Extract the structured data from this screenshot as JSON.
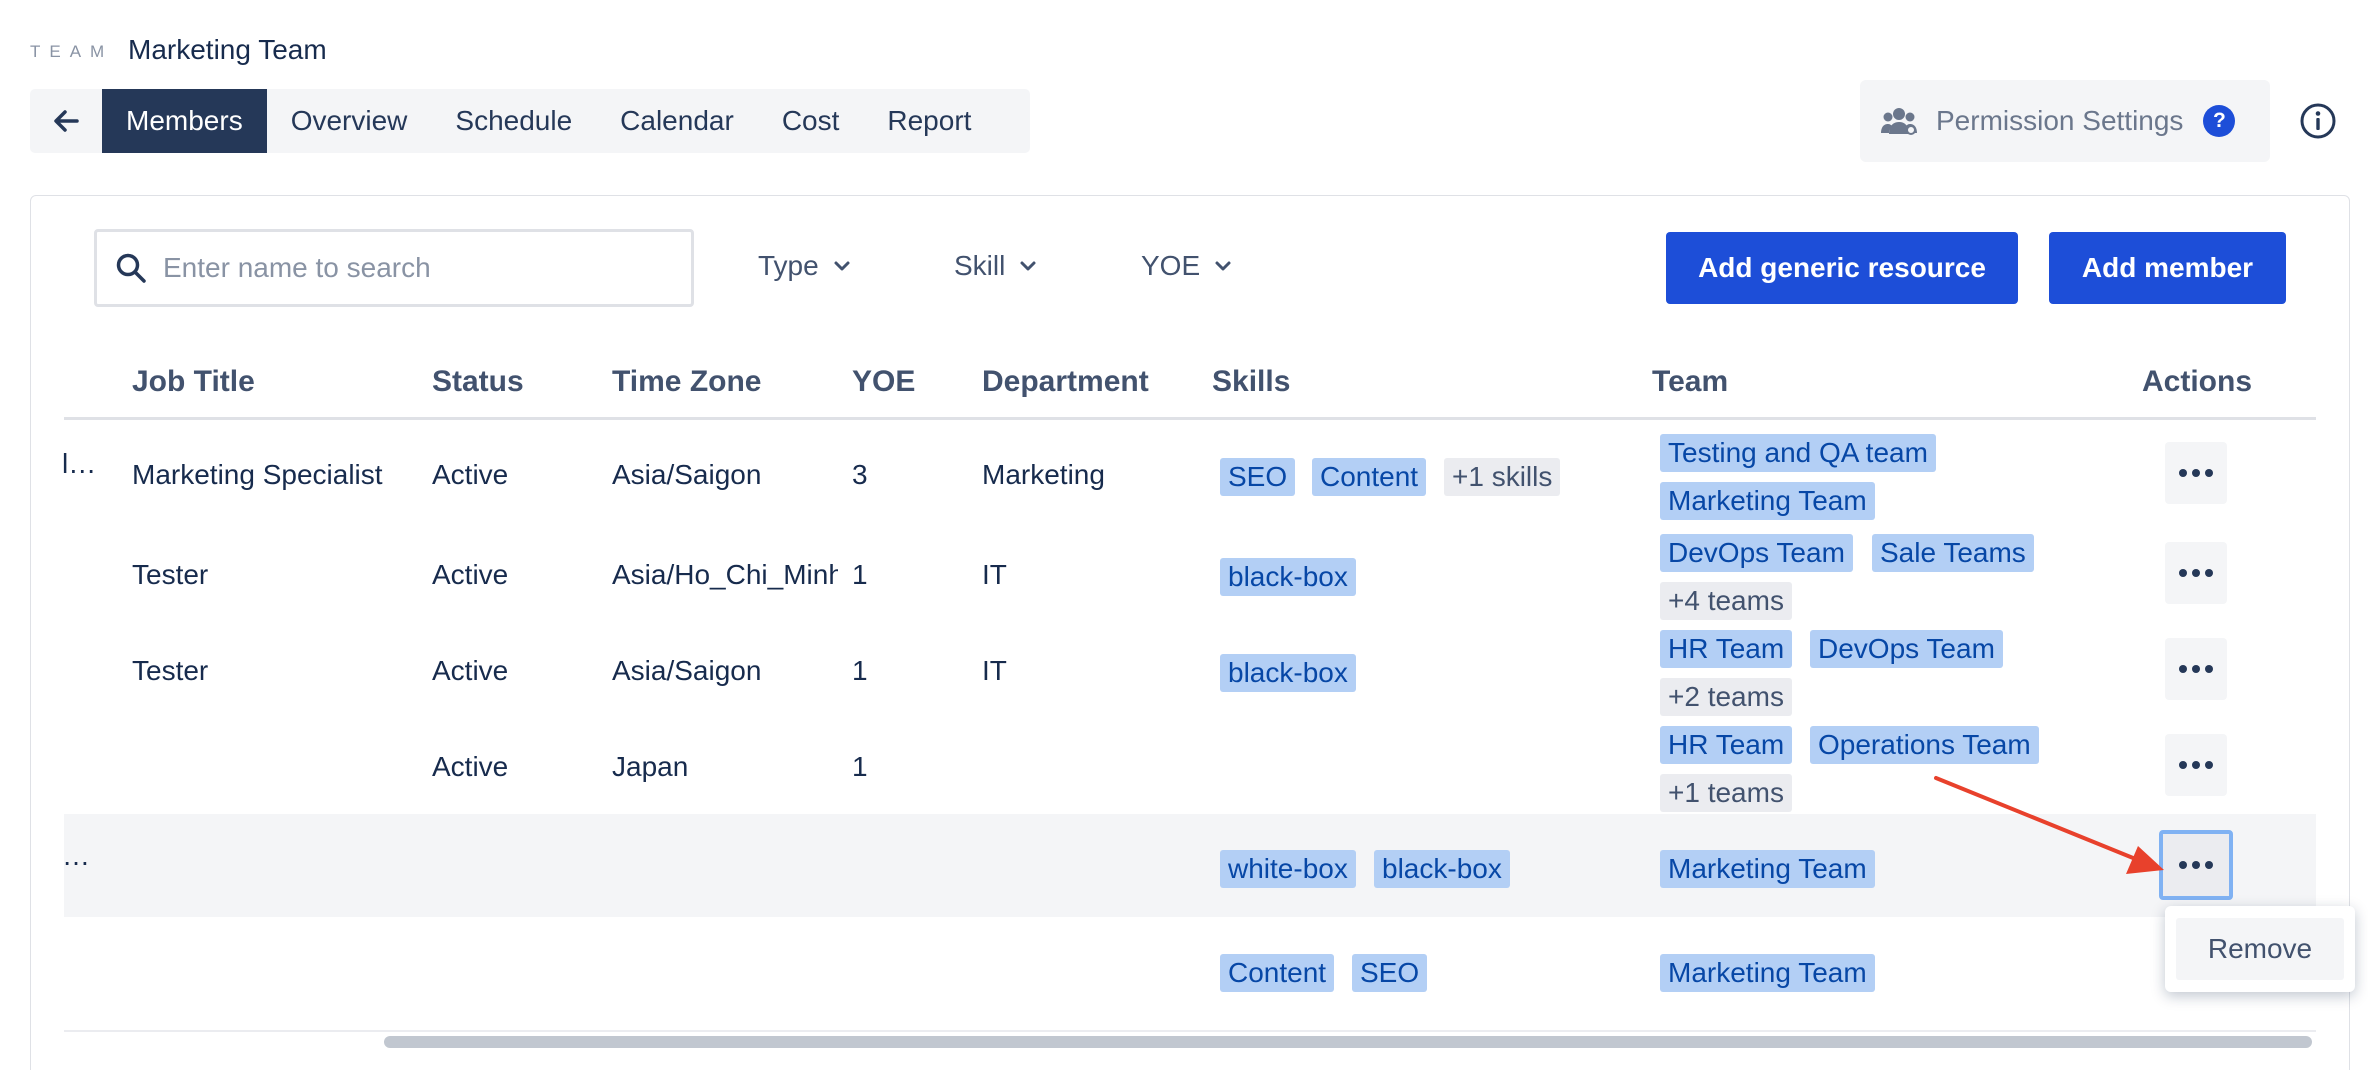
{
  "header": {
    "section_label": "TEAM",
    "team_name": "Marketing Team"
  },
  "tabs": [
    "Members",
    "Overview",
    "Schedule",
    "Calendar",
    "Cost",
    "Report"
  ],
  "active_tab": "Members",
  "permission": {
    "label": "Permission Settings",
    "help": "?"
  },
  "toolbar": {
    "search_placeholder": "Enter name to search",
    "filters": [
      "Type",
      "Skill",
      "YOE"
    ],
    "add_generic_label": "Add generic resource",
    "add_member_label": "Add member"
  },
  "columns": [
    "Job Title",
    "Status",
    "Time Zone",
    "YOE",
    "Department",
    "Skills",
    "Team",
    "Actions"
  ],
  "rows": [
    {
      "name_clip": "l…",
      "job_title": "Marketing Specialist",
      "status": "Active",
      "time_zone": "Asia/Saigon",
      "yoe": "3",
      "department": "Marketing",
      "skills": [
        "SEO",
        "Content"
      ],
      "skills_more": "+1 skills",
      "teams": [
        "Testing and QA team",
        "Marketing Team"
      ],
      "teams_more": ""
    },
    {
      "name_clip": "",
      "job_title": "Tester",
      "status": "Active",
      "time_zone": "Asia/Ho_Chi_Minh",
      "yoe": "1",
      "department": "IT",
      "skills": [
        "black-box"
      ],
      "skills_more": "",
      "teams": [
        "DevOps Team",
        "Sale Teams"
      ],
      "teams_more": "+4 teams"
    },
    {
      "name_clip": "",
      "job_title": "Tester",
      "status": "Active",
      "time_zone": "Asia/Saigon",
      "yoe": "1",
      "department": "IT",
      "skills": [
        "black-box"
      ],
      "skills_more": "",
      "teams": [
        "HR Team",
        "DevOps Team"
      ],
      "teams_more": "+2 teams"
    },
    {
      "name_clip": "",
      "job_title": "",
      "status": "Active",
      "time_zone": "Japan",
      "yoe": "1",
      "department": "",
      "skills": [],
      "skills_more": "",
      "teams": [
        "HR Team",
        "Operations Team"
      ],
      "teams_more": "+1 teams"
    },
    {
      "name_clip": "…",
      "job_title": "",
      "status": "",
      "time_zone": "",
      "yoe": "",
      "department": "",
      "skills": [
        "white-box",
        "black-box"
      ],
      "skills_more": "",
      "teams": [
        "Marketing Team"
      ],
      "teams_more": ""
    },
    {
      "name_clip": "",
      "job_title": "",
      "status": "",
      "time_zone": "",
      "yoe": "",
      "department": "",
      "skills": [
        "Content",
        "SEO"
      ],
      "skills_more": "",
      "teams": [
        "Marketing Team"
      ],
      "teams_more": ""
    }
  ],
  "context_menu": {
    "remove_label": "Remove"
  },
  "colors": {
    "primary": "#1d4ed8",
    "nav_active": "#253858",
    "tag_bg": "#b3cff5",
    "tag_text": "#0747a6",
    "annotation_arrow": "#e8412c"
  }
}
